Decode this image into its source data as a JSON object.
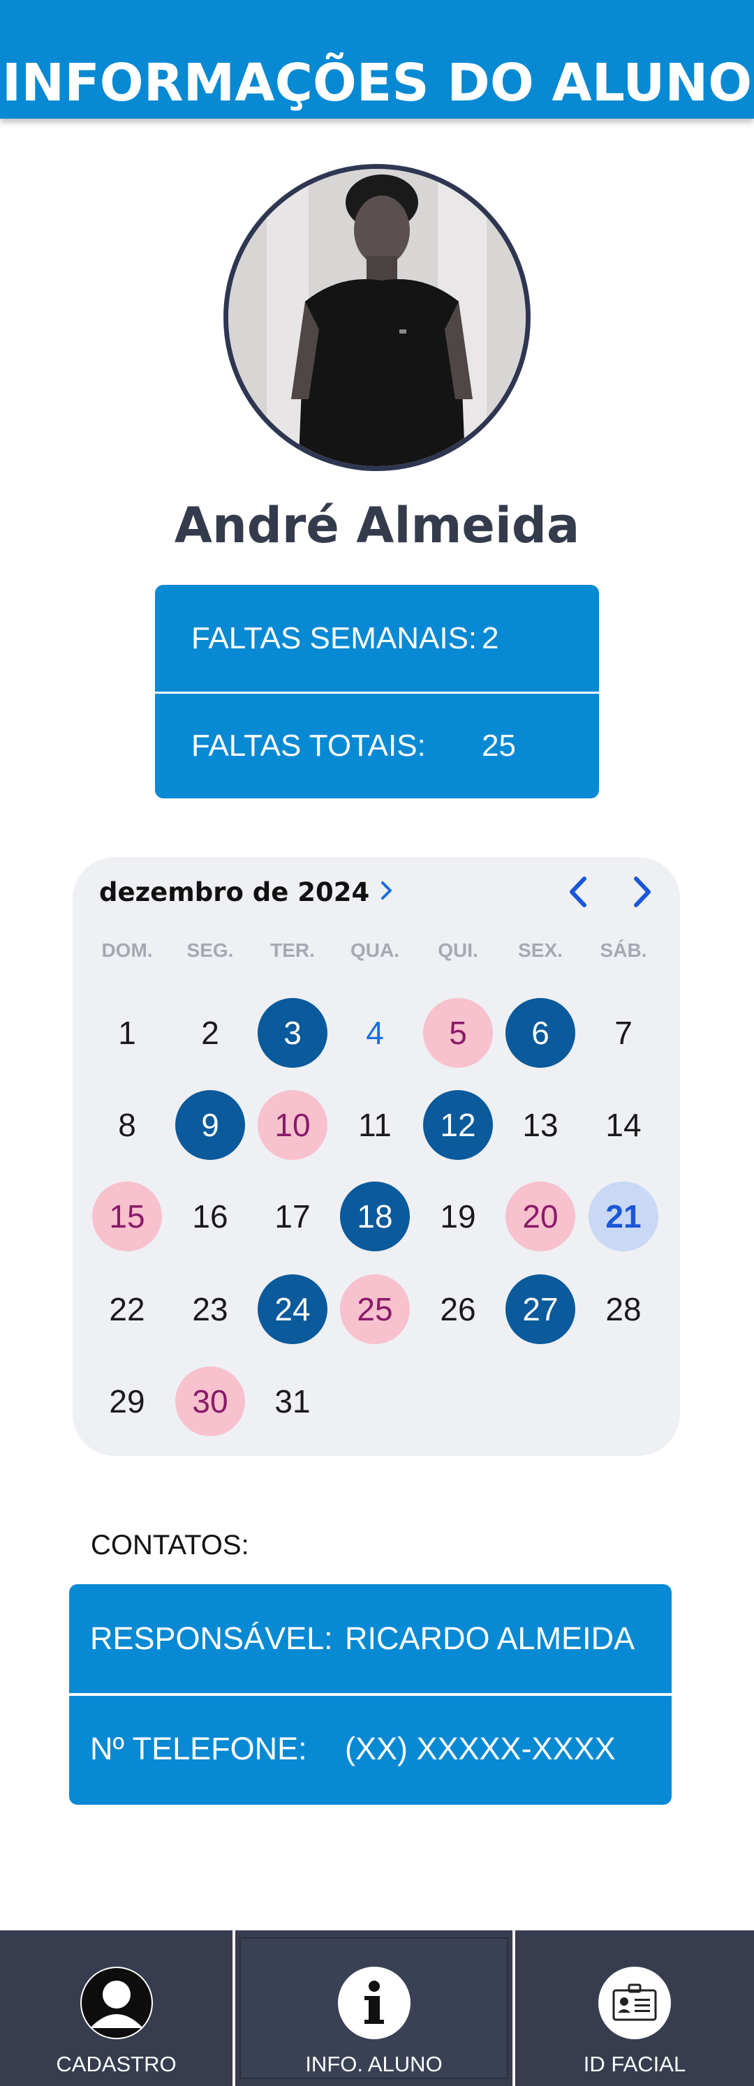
{
  "header": {
    "title": "INFORMAÇÕES DO ALUNO"
  },
  "student": {
    "name": "André Almeida",
    "photo_icon": "student-photo"
  },
  "absences": {
    "weekly_label": "FALTAS SEMANAIS:",
    "weekly_value": "2",
    "total_label": "FALTAS TOTAIS:",
    "total_value": "25"
  },
  "calendar": {
    "month_label": "dezembro de 2024",
    "weekdays": [
      "DOM.",
      "SEG.",
      "TER.",
      "QUA.",
      "QUI.",
      "SEX.",
      "SÁB."
    ],
    "colors": {
      "present": "#0a5a9c",
      "absent": "#f7c1cd",
      "today": "#c8d8f5"
    },
    "days": [
      {
        "n": "1",
        "s": ""
      },
      {
        "n": "2",
        "s": ""
      },
      {
        "n": "3",
        "s": "present"
      },
      {
        "n": "4",
        "s": "highlight"
      },
      {
        "n": "5",
        "s": "absent"
      },
      {
        "n": "6",
        "s": "present"
      },
      {
        "n": "7",
        "s": ""
      },
      {
        "n": "8",
        "s": ""
      },
      {
        "n": "9",
        "s": "present"
      },
      {
        "n": "10",
        "s": "absent"
      },
      {
        "n": "11",
        "s": ""
      },
      {
        "n": "12",
        "s": "present"
      },
      {
        "n": "13",
        "s": ""
      },
      {
        "n": "14",
        "s": ""
      },
      {
        "n": "15",
        "s": "absent"
      },
      {
        "n": "16",
        "s": ""
      },
      {
        "n": "17",
        "s": ""
      },
      {
        "n": "18",
        "s": "present"
      },
      {
        "n": "19",
        "s": ""
      },
      {
        "n": "20",
        "s": "absent"
      },
      {
        "n": "21",
        "s": "today"
      },
      {
        "n": "22",
        "s": ""
      },
      {
        "n": "23",
        "s": ""
      },
      {
        "n": "24",
        "s": "present"
      },
      {
        "n": "25",
        "s": "absent"
      },
      {
        "n": "26",
        "s": ""
      },
      {
        "n": "27",
        "s": "present"
      },
      {
        "n": "28",
        "s": ""
      },
      {
        "n": "29",
        "s": ""
      },
      {
        "n": "30",
        "s": "absent"
      },
      {
        "n": "31",
        "s": ""
      }
    ]
  },
  "contacts": {
    "section_label": "CONTATOS:",
    "guardian_label": "RESPONSÁVEL:",
    "guardian_value": "RICARDO ALMEIDA",
    "phone_label": "Nº TELEFONE:",
    "phone_value": "(XX) XXXXX-XXXX"
  },
  "bottom_nav": {
    "items": [
      {
        "label": "CADASTRO",
        "icon": "user-icon"
      },
      {
        "label": "INFO. ALUNO",
        "icon": "info-icon"
      },
      {
        "label": "ID FACIAL",
        "icon": "id-card-icon"
      }
    ]
  }
}
